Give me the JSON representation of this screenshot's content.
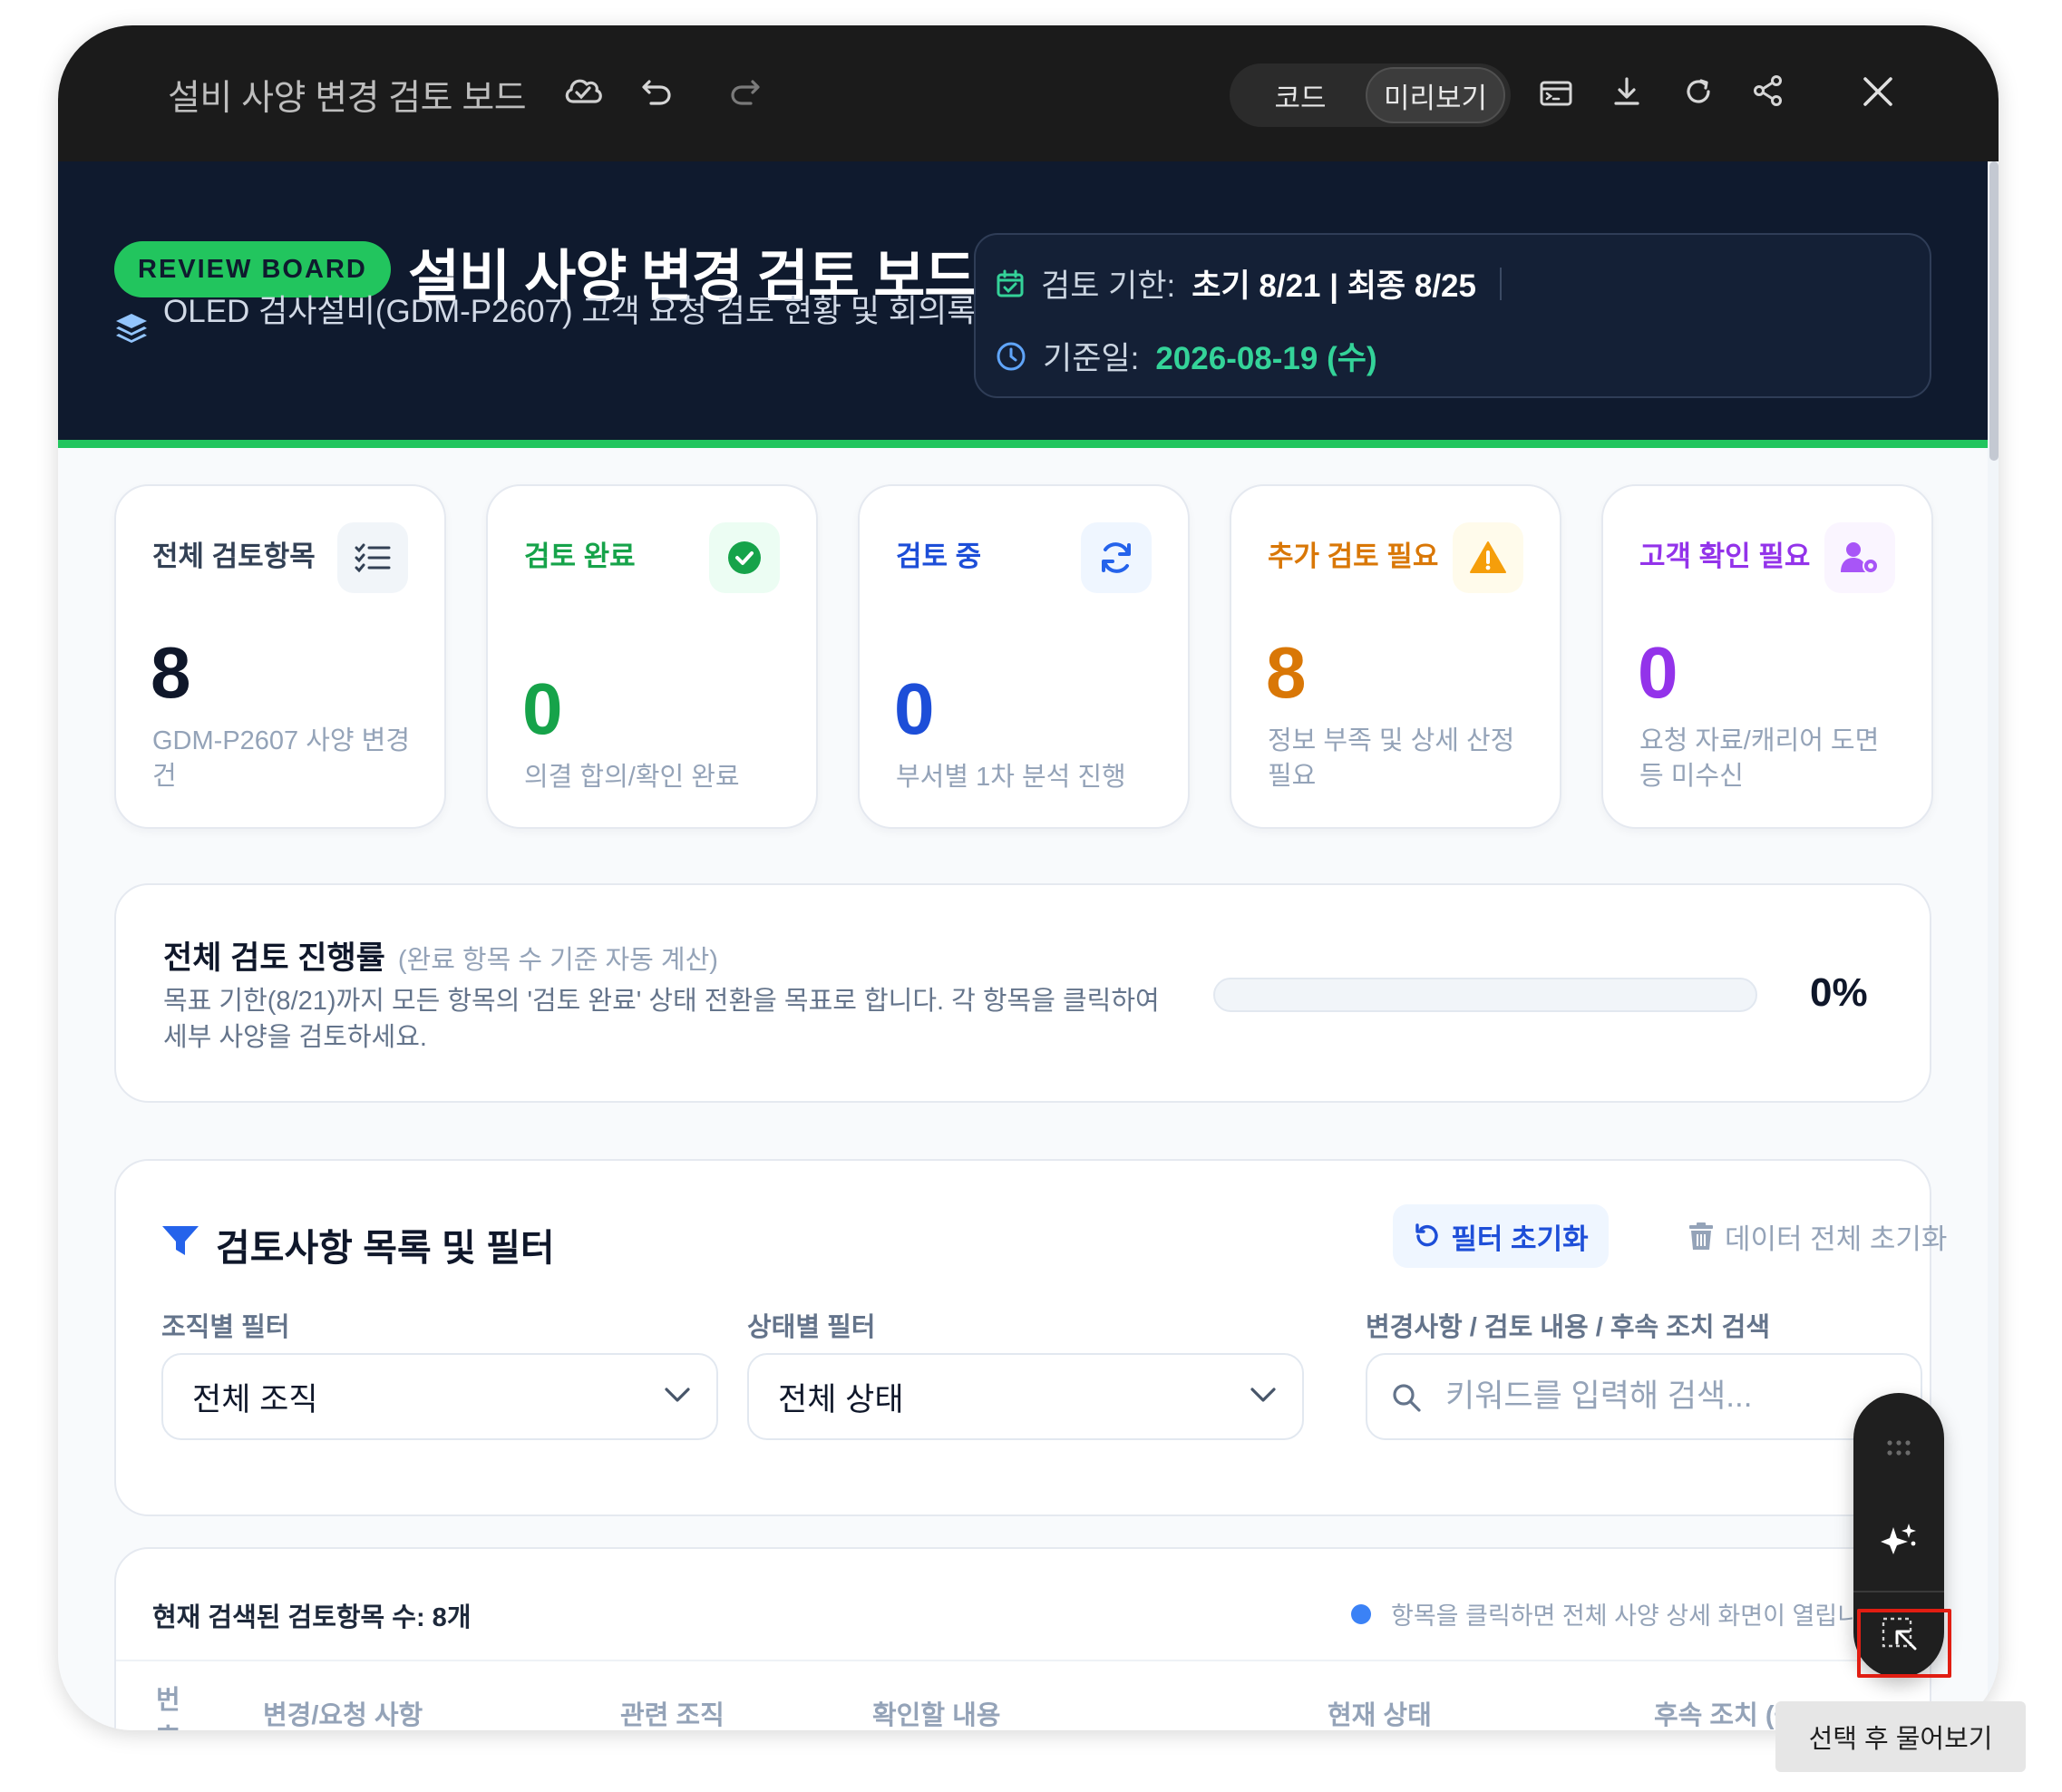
{
  "window": {
    "title": "설비 사양 변경 검토 보드",
    "mode_tabs": [
      {
        "label": "코드",
        "active": false
      },
      {
        "label": "미리보기",
        "active": true
      }
    ],
    "icons": [
      "cloud-check-icon",
      "undo-icon",
      "redo-icon",
      "terminal-icon",
      "download-icon",
      "refresh-icon",
      "share-icon",
      "close-icon"
    ]
  },
  "header": {
    "badge": "REVIEW BOARD",
    "title": "설비 사양 변경 검토 보드",
    "subtitle": "OLED 검사설비(GDM-P2607) 고객 요청 검토 현황 및 회의록",
    "deadline_label": "검토 기한:",
    "deadline_value": "초기 8/21 | 최종 8/25",
    "base_date_label": "기준일:",
    "base_date_value": "2026-08-19 (수)",
    "accent_color": "#22c55e",
    "bg_color": "#0f1a2e"
  },
  "stats": [
    {
      "label": "전체 검토항목",
      "value": "8",
      "desc": "GDM-P2607 사양 변경 건",
      "color": "#0f172a",
      "icon": "checklist-icon"
    },
    {
      "label": "검토 완료",
      "value": "0",
      "desc": "의결 합의/확인 완료",
      "color": "#16a34a",
      "icon": "check-circle-icon"
    },
    {
      "label": "검토 중",
      "value": "0",
      "desc": "부서별 1차 분석 진행",
      "color": "#1d4ed8",
      "icon": "sync-icon"
    },
    {
      "label": "추가 검토 필요",
      "value": "8",
      "desc": "정보 부족 및 상세 산정 필요",
      "color": "#d97706",
      "icon": "warning-icon"
    },
    {
      "label": "고객 확인 필요",
      "value": "0",
      "desc": "요청 자료/캐리어 도면 등 미수신",
      "color": "#9333ea",
      "icon": "user-gear-icon"
    }
  ],
  "progress": {
    "title": "전체 검토 진행률",
    "note": "(완료 항목 수 기준 자동 계산)",
    "desc": "목표 기한(8/21)까지 모든 항목의 '검토 완료' 상태 전환을 목표로 합니다. 각 항목을 클릭하여 세부 사양을 검토하세요.",
    "percent_label": "0%",
    "fraction": 0
  },
  "filters": {
    "title": "검토사항 목록 및 필터",
    "reset_label": "필터 초기화",
    "clear_label": "데이터 전체 초기화",
    "org_label": "조직별 필터",
    "org_value": "전체 조직",
    "status_label": "상태별 필터",
    "status_value": "전체 상태",
    "search_label": "변경사항 / 검토 내용 / 후속 조치 검색",
    "search_placeholder": "키워드를 입력해 검색..."
  },
  "list": {
    "count_text": "현재 검색된 검토항목 수: 8개",
    "hint": "항목을 클릭하면 전체 사양 상세 화면이 열립니",
    "columns": [
      "번호",
      "변경/요청 사항",
      "관련 조직",
      "확인할 내용",
      "현재 상태",
      "후속 조치 (근거자료)"
    ]
  },
  "floating_toolbar": {
    "icons": [
      "drag-handle-icon",
      "sparkle-icon",
      "select-area-icon"
    ],
    "tooltip": "선택 후 물어보기"
  }
}
